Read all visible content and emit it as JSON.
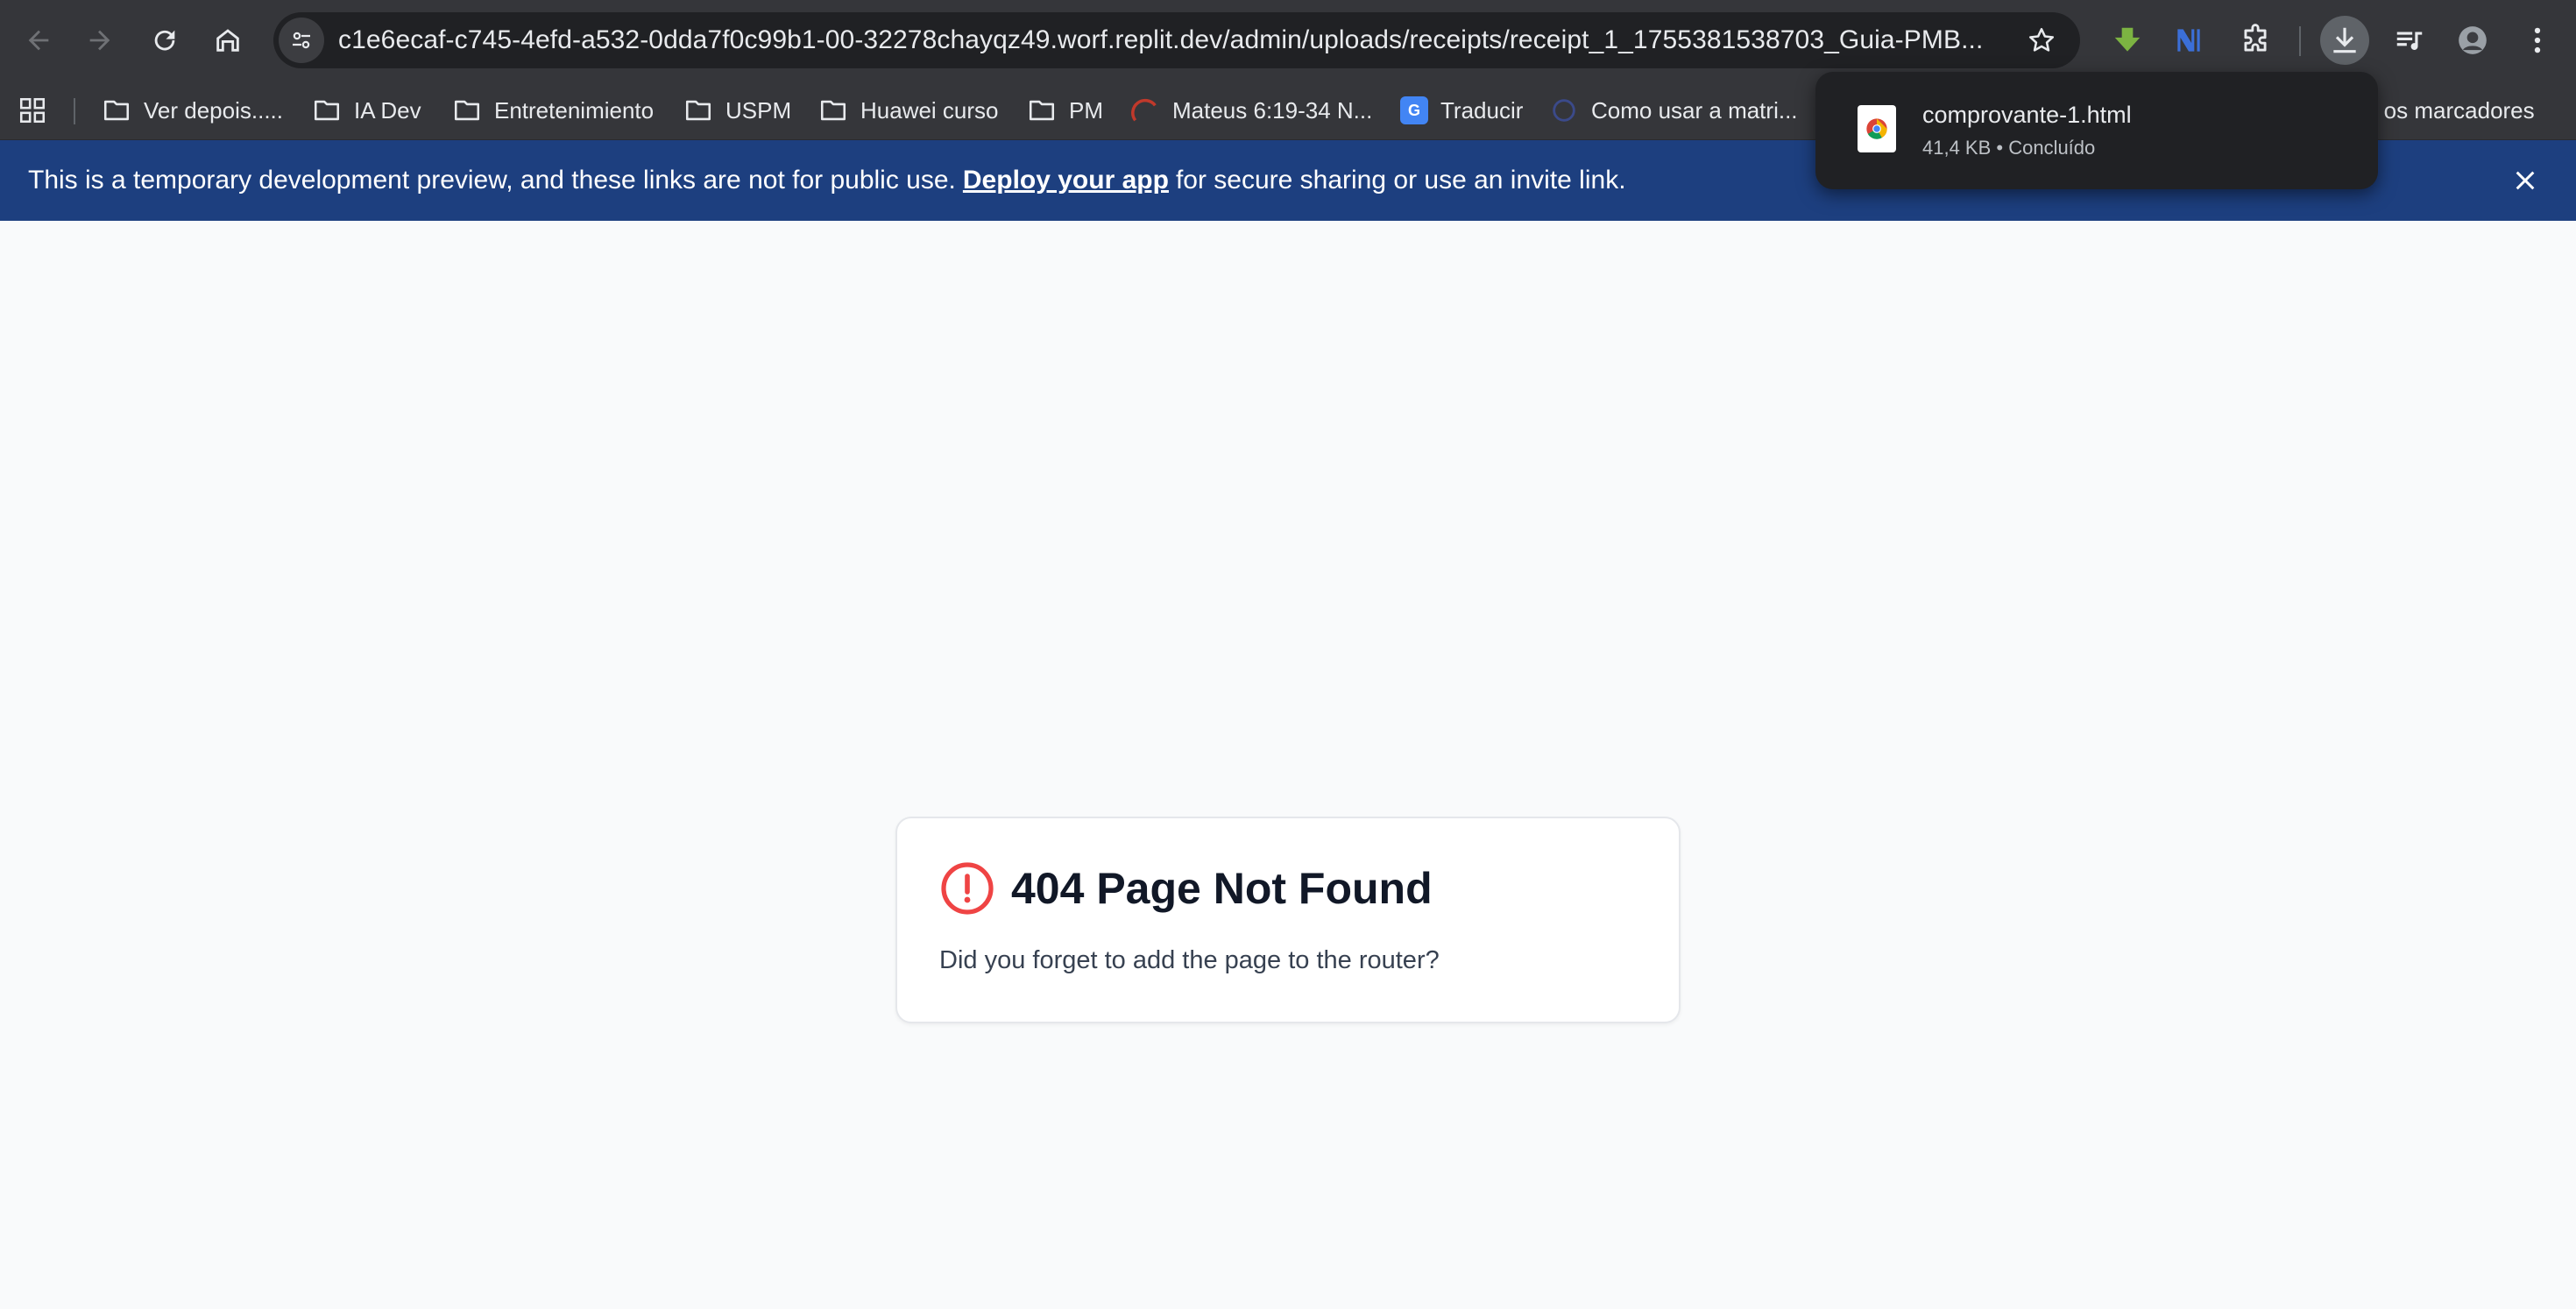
{
  "browser": {
    "url": "c1e6ecaf-c745-4efd-a532-0dda7f0c99b1-00-32278chayqz49.worf.replit.dev/admin/uploads/receipts/receipt_1_1755381538703_Guia-PMB...",
    "bookmarks": [
      {
        "label": "Ver depois.....",
        "icon": "folder-icon"
      },
      {
        "label": "IA Dev",
        "icon": "folder-icon"
      },
      {
        "label": "Entretenimiento",
        "icon": "folder-icon"
      },
      {
        "label": "USPM",
        "icon": "folder-icon"
      },
      {
        "label": "Huawei curso",
        "icon": "folder-icon"
      },
      {
        "label": "PM",
        "icon": "folder-icon"
      },
      {
        "label": "Mateus 6:19-34 N...",
        "icon": "site-favicon"
      },
      {
        "label": "Traducir",
        "icon": "translate-icon"
      },
      {
        "label": "Como usar a matri...",
        "icon": "site-favicon"
      },
      {
        "label": "os os marcadores",
        "icon": "none"
      }
    ]
  },
  "download": {
    "filename": "comprovante-1.html",
    "meta": "41,4 KB • Concluído"
  },
  "banner": {
    "text_before": "This is a temporary development preview, and these links are not for public use.",
    "link": "Deploy your app",
    "text_after": "for secure sharing or use an invite link."
  },
  "error": {
    "title": "404 Page Not Found",
    "message": "Did you forget to add the page to the router?",
    "icon_color": "#ef4444"
  }
}
